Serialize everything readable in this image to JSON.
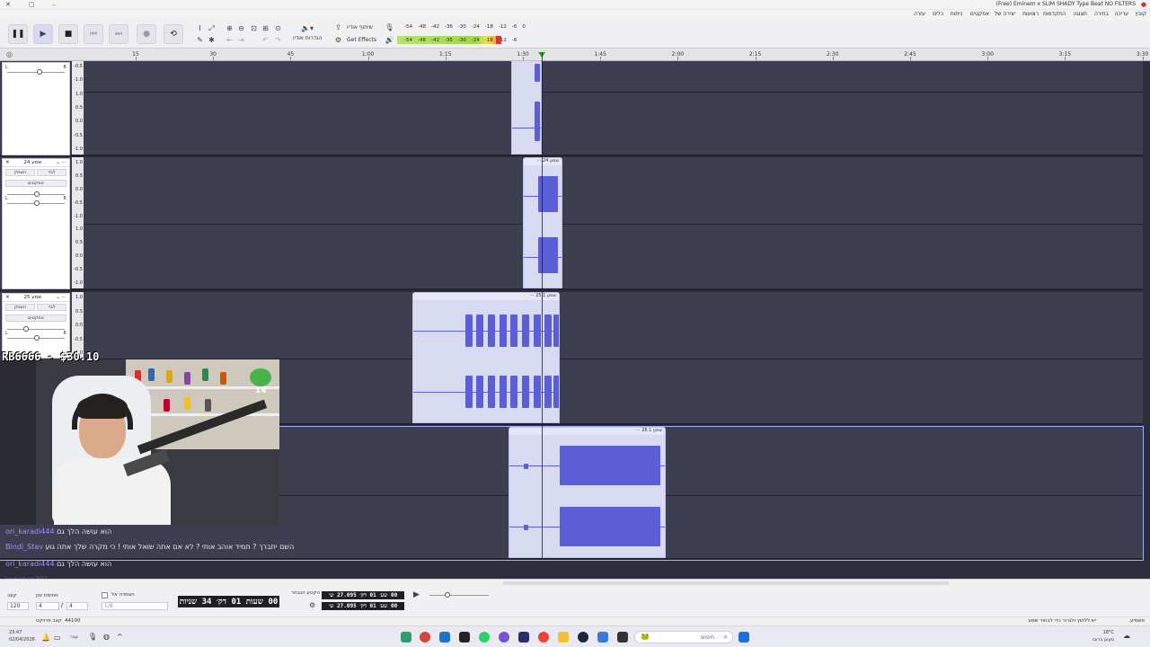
{
  "window": {
    "title": "(Free) Eminem x SLIM SHADY Type Beat  NO FILTERS"
  },
  "menu": [
    {
      "label": "קובץ"
    },
    {
      "label": "עריכה"
    },
    {
      "label": "בחירה"
    },
    {
      "label": "תצוגה"
    },
    {
      "label": "התקדמות"
    },
    {
      "label": "רצועות"
    },
    {
      "label": "יצירה של"
    },
    {
      "label": "אפקטים"
    },
    {
      "label": "ניתוח"
    },
    {
      "label": "כלים"
    },
    {
      "label": "עזרה"
    }
  ],
  "toolbar": {
    "share_audio": "שיתוף אודיו",
    "get_effects": "Get Effects",
    "audio_setup": "הגדרות אודיו",
    "meter_top_ticks": [
      "-54",
      "-48",
      "-42",
      "-36",
      "-30",
      "-24",
      "-18",
      "-12",
      "-6",
      "0"
    ],
    "meter_bottom_ticks": [
      "-54",
      "-48",
      "-42",
      "-36",
      "-30",
      "-24",
      "-18",
      "-12",
      "-6"
    ],
    "meter_level": 0.92
  },
  "ruler": {
    "ticks": [
      "15",
      "30",
      "45",
      "1:00",
      "1:15",
      "1:30",
      "1:45",
      "2:00",
      "2:15",
      "2:30",
      "2:45",
      "3:00",
      "3:15",
      "3:30"
    ]
  },
  "tracks": [
    {
      "name": "",
      "scale": [
        "-0.5",
        "-1.0",
        "1.0",
        "0.5",
        "0.0",
        "-0.5",
        "-1.0"
      ],
      "clips": [
        {
          "label": ""
        }
      ]
    },
    {
      "name": "שמע 24",
      "mute": "השתק",
      "solo": "לבד",
      "effects": "אפקטים",
      "scale": [
        "1.0",
        "0.5",
        "0.0",
        "-0.5",
        "-1.0",
        "1.0",
        "0.5",
        "0.0",
        "-0.5",
        "-1.0"
      ],
      "clips": [
        {
          "label": "שמע 24"
        }
      ]
    },
    {
      "name": "שמע 25",
      "mute": "השתק",
      "solo": "לבד",
      "effects": "אפקטים",
      "scale": [
        "1.0",
        "0.5",
        "0.0",
        "-0.5",
        "-1.0"
      ],
      "clips": [
        {
          "label": "שמע 25.1"
        }
      ]
    },
    {
      "name": "",
      "scale": [],
      "clips": [
        {
          "label": "שמע 26.1"
        }
      ]
    }
  ],
  "overlay": {
    "donation": "RB6666 - $30.10",
    "frog_badge": "14"
  },
  "chat": [
    {
      "user": "ori_karadi444",
      "text": "הוא עושה הלך גם",
      "faded": false
    },
    {
      "user": "Bindi_Stav",
      "text": "השם יתברך ? תמיד אוהב אותי ? לא אם אתה שואל אותי ! כי מקרה שלך אתה גוע",
      "faded": false
    },
    {
      "user": "ori_karadi444",
      "text": "הוא עושה הלך גם",
      "faded": false
    },
    {
      "user": "yonatan391",
      "text": "",
      "faded": true
    }
  ],
  "bottom": {
    "project_rate_label": "קצב",
    "project_rate": "120",
    "time_signature_label": "חתימת זמן",
    "ts_num": "4",
    "ts_den": "4",
    "snap_label": "הצמדה אל",
    "snap_value": "1/8",
    "time_display": "00 שעות 01 דק׳ 34 שניות",
    "selection_label": "הקטע הנבחר",
    "sel_start": "00 שע׳ 01 דק׳ 27.095 ש׳",
    "sel_end": "00 שע׳ 01 דק׳ 27.095 ש׳",
    "rate_status": "44100",
    "rate_status_label": "קצב פרויקט"
  },
  "status": {
    "left": "משמיע.",
    "hint": "יש ללחוץ ולגרור כדי לבחור שמע"
  },
  "taskbar": {
    "time": "23:47",
    "date": "02/04/2026",
    "lang": "עבר",
    "search_placeholder": "חיפוש",
    "weather_temp": "18°C",
    "weather_desc": "מעונן ברובו"
  }
}
